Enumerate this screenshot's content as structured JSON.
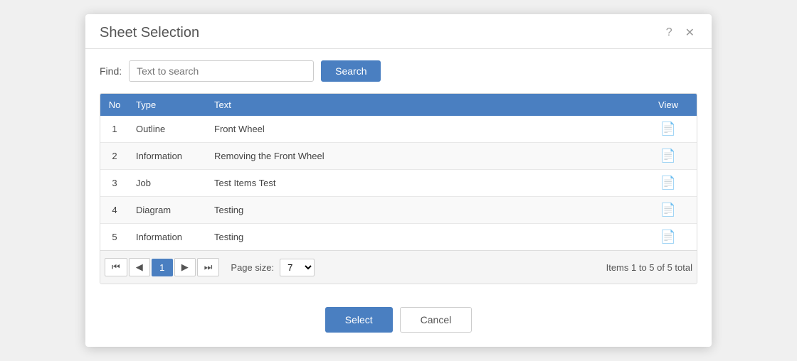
{
  "modal": {
    "title": "Sheet Selection",
    "help_icon": "?",
    "close_icon": "✕"
  },
  "search": {
    "find_label": "Find:",
    "placeholder": "Text to search",
    "button_label": "Search"
  },
  "table": {
    "columns": [
      {
        "key": "no",
        "label": "No"
      },
      {
        "key": "type",
        "label": "Type"
      },
      {
        "key": "text",
        "label": "Text"
      },
      {
        "key": "view",
        "label": "View"
      }
    ],
    "rows": [
      {
        "no": "1",
        "type": "Outline",
        "text": "Front Wheel"
      },
      {
        "no": "2",
        "type": "Information",
        "text": "Removing the Front Wheel"
      },
      {
        "no": "3",
        "type": "Job",
        "text": "Test Items Test"
      },
      {
        "no": "4",
        "type": "Diagram",
        "text": "Testing"
      },
      {
        "no": "5",
        "type": "Information",
        "text": "Testing"
      }
    ]
  },
  "pagination": {
    "first_label": "⏮",
    "prev_label": "◀",
    "current_page": "1",
    "next_label": "▶",
    "last_label": "⏭",
    "page_size_label": "Page size:",
    "page_size_value": "7",
    "items_info": "Items 1 to 5 of 5 total"
  },
  "footer": {
    "select_label": "Select",
    "cancel_label": "Cancel"
  }
}
